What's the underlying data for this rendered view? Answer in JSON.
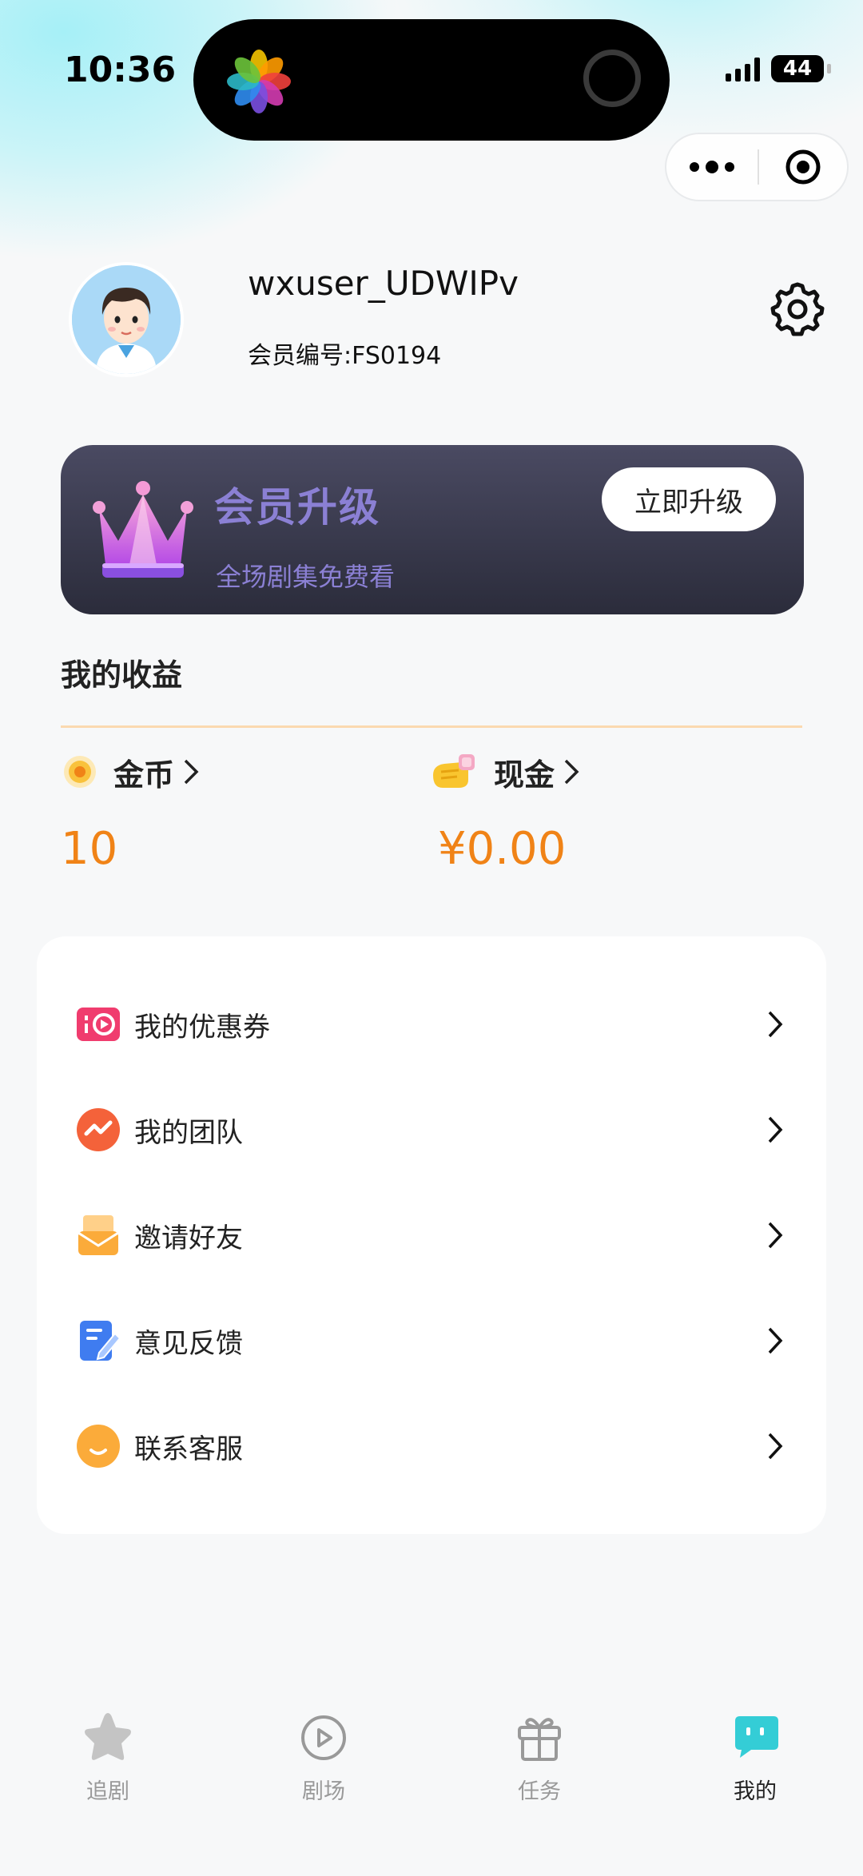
{
  "status_bar": {
    "time": "10:36",
    "battery": "44"
  },
  "profile": {
    "username": "wxuser_UDWIPv",
    "member_id": "会员编号:FS0194"
  },
  "vip": {
    "title": "会员升级",
    "subtitle": "全场剧集免费看",
    "button": "立即升级"
  },
  "earnings": {
    "title": "我的收益",
    "coins_label": "金币",
    "coins_value": "10",
    "cash_label": "现金",
    "cash_value": "¥0.00"
  },
  "menu": {
    "items": [
      {
        "label": "我的优惠券",
        "icon": "coupon-icon"
      },
      {
        "label": "我的团队",
        "icon": "team-icon"
      },
      {
        "label": "邀请好友",
        "icon": "invite-icon"
      },
      {
        "label": "意见反馈",
        "icon": "feedback-icon"
      },
      {
        "label": "联系客服",
        "icon": "customer-service-icon"
      }
    ]
  },
  "tabbar": {
    "tabs": [
      {
        "label": "追剧",
        "icon": "star-icon",
        "active": false
      },
      {
        "label": "剧场",
        "icon": "play-circle-icon",
        "active": false
      },
      {
        "label": "任务",
        "icon": "gift-icon",
        "active": false
      },
      {
        "label": "我的",
        "icon": "profile-chat-icon",
        "active": true
      }
    ]
  },
  "colors": {
    "accent_orange": "#f08317",
    "vip_text": "#8b80d4",
    "vip_card": "#2b2c3b",
    "active_tab": "#34cdd6"
  }
}
